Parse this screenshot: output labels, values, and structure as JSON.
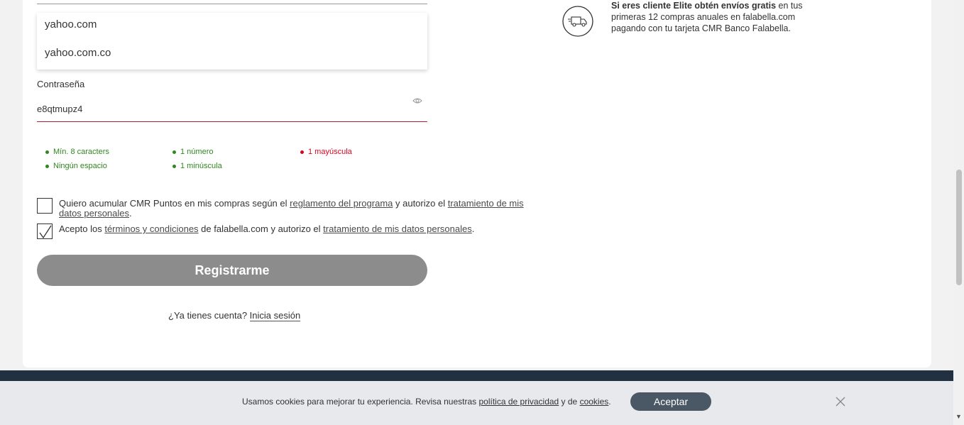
{
  "email_suggestions": [
    "yahoo.com",
    "yahoo.com.co"
  ],
  "password": {
    "label": "Contraseña",
    "value": "e8qtmupz4"
  },
  "password_rules": [
    {
      "text": "Mín. 8 caracters",
      "status": "ok"
    },
    {
      "text": "1 número",
      "status": "ok"
    },
    {
      "text": "1 mayúscula",
      "status": "bad"
    },
    {
      "text": "Ningún espacio",
      "status": "ok"
    },
    {
      "text": "1 minúscula",
      "status": "ok"
    }
  ],
  "consent_cmr": {
    "checked": false,
    "text_1": "Quiero acumular CMR Puntos en mis compras según el ",
    "link_1": "reglamento del programa",
    "text_2": "  y autorizo el ",
    "link_2": "tratamiento de mis datos personales",
    "text_3": "."
  },
  "consent_terms": {
    "checked": true,
    "text_1": "Acepto los ",
    "link_1": "términos y condiciones",
    "text_2": " de falabella.com  y autorizo el ",
    "link_2": "tratamiento de mis datos personales",
    "text_3": "."
  },
  "register_button": "Registrarme",
  "login": {
    "prompt": "¿Ya tienes cuenta? ",
    "link": "Inicia sesión"
  },
  "elite_benefit": {
    "bold": "Si eres cliente Elite obtén envíos gratis",
    "rest": " en tus primeras 12 compras anuales en falabella.com pagando con tu tarjeta CMR Banco Falabella."
  },
  "cookie_bar": {
    "text_1": "Usamos cookies para mejorar tu experiencia. Revisa nuestras ",
    "link_1": "política de privacidad",
    "text_2": " y de ",
    "link_2": "cookies",
    "text_3": ".",
    "accept": "Aceptar"
  },
  "colors": {
    "rule_ok": "#30871f",
    "rule_bad": "#dd0021",
    "button_disabled": "#8c8c8c",
    "accept_button": "#4a5866",
    "footer": "#223142"
  }
}
